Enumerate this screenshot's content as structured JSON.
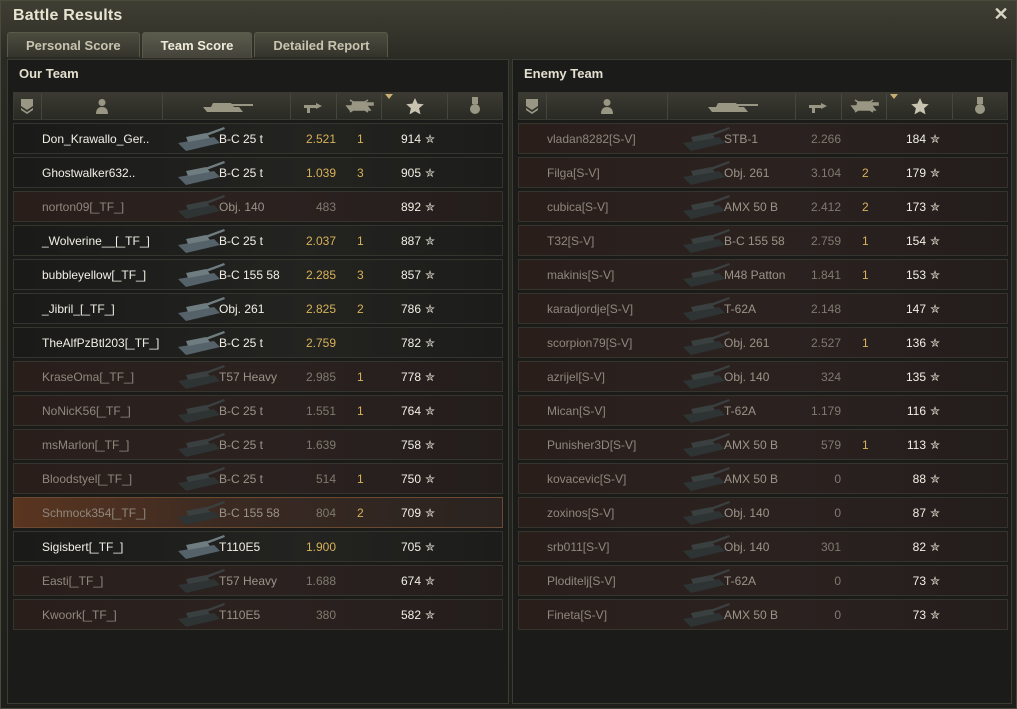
{
  "window": {
    "title": "Battle Results",
    "close": "✕"
  },
  "tabs": [
    "Personal Score",
    "Team Score",
    "Detailed Report"
  ],
  "our_team": {
    "title": "Our Team",
    "rows": [
      {
        "name": "Don_Krawallo_Ger..",
        "tank": "B-C 25 t",
        "damage": "2.521",
        "kills": "1",
        "xp": "914",
        "dead": false,
        "player": false
      },
      {
        "name": "Ghostwalker632..",
        "tank": "B-C 25 t",
        "damage": "1.039",
        "kills": "3",
        "xp": "905",
        "dead": false,
        "player": false
      },
      {
        "name": "norton09[_TF_]",
        "tank": "Obj. 140",
        "damage": "483",
        "kills": "",
        "xp": "892",
        "dead": true,
        "player": false
      },
      {
        "name": "_Wolverine__[_TF_]",
        "tank": "B-C 25 t",
        "damage": "2.037",
        "kills": "1",
        "xp": "887",
        "dead": false,
        "player": false
      },
      {
        "name": "bubbleyellow[_TF_]",
        "tank": "B-C 155 58",
        "damage": "2.285",
        "kills": "3",
        "xp": "857",
        "dead": false,
        "player": false
      },
      {
        "name": "_Jibril_[_TF_]",
        "tank": "Obj. 261",
        "damage": "2.825",
        "kills": "2",
        "xp": "786",
        "dead": false,
        "player": false
      },
      {
        "name": "TheAlfPzBtl203[_TF_]",
        "tank": "B-C 25 t",
        "damage": "2.759",
        "kills": "",
        "xp": "782",
        "dead": false,
        "player": false
      },
      {
        "name": "KraseOma[_TF_]",
        "tank": "T57 Heavy",
        "damage": "2.985",
        "kills": "1",
        "xp": "778",
        "dead": true,
        "player": false
      },
      {
        "name": "NoNicK56[_TF_]",
        "tank": "B-C 25 t",
        "damage": "1.551",
        "kills": "1",
        "xp": "764",
        "dead": true,
        "player": false
      },
      {
        "name": "msMarlon[_TF_]",
        "tank": "B-C 25 t",
        "damage": "1.639",
        "kills": "",
        "xp": "758",
        "dead": true,
        "player": false
      },
      {
        "name": "Bloodstyel[_TF_]",
        "tank": "B-C 25 t",
        "damage": "514",
        "kills": "1",
        "xp": "750",
        "dead": true,
        "player": false
      },
      {
        "name": "Schmock354[_TF_]",
        "tank": "B-C 155 58",
        "damage": "804",
        "kills": "2",
        "xp": "709",
        "dead": true,
        "player": true
      },
      {
        "name": "Sigisbert[_TF_]",
        "tank": "T110E5",
        "damage": "1.900",
        "kills": "",
        "xp": "705",
        "dead": false,
        "player": false
      },
      {
        "name": "Easti[_TF_]",
        "tank": "T57 Heavy",
        "damage": "1.688",
        "kills": "",
        "xp": "674",
        "dead": true,
        "player": false
      },
      {
        "name": "Kwoork[_TF_]",
        "tank": "T110E5",
        "damage": "380",
        "kills": "",
        "xp": "582",
        "dead": true,
        "player": false
      }
    ]
  },
  "enemy_team": {
    "title": "Enemy Team",
    "rows": [
      {
        "name": "vladan8282[S-V]",
        "tank": "STB-1",
        "damage": "2.266",
        "kills": "",
        "xp": "184"
      },
      {
        "name": "Filga[S-V]",
        "tank": "Obj. 261",
        "damage": "3.104",
        "kills": "2",
        "xp": "179"
      },
      {
        "name": "cubica[S-V]",
        "tank": "AMX 50 B",
        "damage": "2.412",
        "kills": "2",
        "xp": "173"
      },
      {
        "name": "T32[S-V]",
        "tank": "B-C 155 58",
        "damage": "2.759",
        "kills": "1",
        "xp": "154"
      },
      {
        "name": "makinis[S-V]",
        "tank": "M48 Patton",
        "damage": "1.841",
        "kills": "1",
        "xp": "153"
      },
      {
        "name": "karadjordje[S-V]",
        "tank": "T-62A",
        "damage": "2.148",
        "kills": "",
        "xp": "147"
      },
      {
        "name": "scorpion79[S-V]",
        "tank": "Obj. 261",
        "damage": "2.527",
        "kills": "1",
        "xp": "136"
      },
      {
        "name": "azrijel[S-V]",
        "tank": "Obj. 140",
        "damage": "324",
        "kills": "",
        "xp": "135"
      },
      {
        "name": "Mican[S-V]",
        "tank": "T-62A",
        "damage": "1.179",
        "kills": "",
        "xp": "116"
      },
      {
        "name": "Punisher3D[S-V]",
        "tank": "AMX 50 B",
        "damage": "579",
        "kills": "1",
        "xp": "113"
      },
      {
        "name": "kovacevic[S-V]",
        "tank": "AMX 50 B",
        "damage": "0",
        "kills": "",
        "xp": "88"
      },
      {
        "name": "zoxinos[S-V]",
        "tank": "Obj. 140",
        "damage": "0",
        "kills": "",
        "xp": "87"
      },
      {
        "name": "srb011[S-V]",
        "tank": "Obj. 140",
        "damage": "301",
        "kills": "",
        "xp": "82"
      },
      {
        "name": "Ploditelj[S-V]",
        "tank": "T-62A",
        "damage": "0",
        "kills": "",
        "xp": "73"
      },
      {
        "name": "Fineta[S-V]",
        "tank": "AMX 50 B",
        "damage": "0",
        "kills": "",
        "xp": "73"
      }
    ]
  },
  "icons": {
    "columns": [
      "rank-icon",
      "player-icon",
      "tank-icon",
      "damage-icon",
      "kills-icon",
      "xp-star-icon",
      "medal-icon"
    ],
    "star": "✮"
  },
  "colors": {
    "damage": "#d8b25a",
    "alive_text": "#f2f0e6",
    "dead_text": "#8f887e",
    "player_row": "#5a3520"
  }
}
